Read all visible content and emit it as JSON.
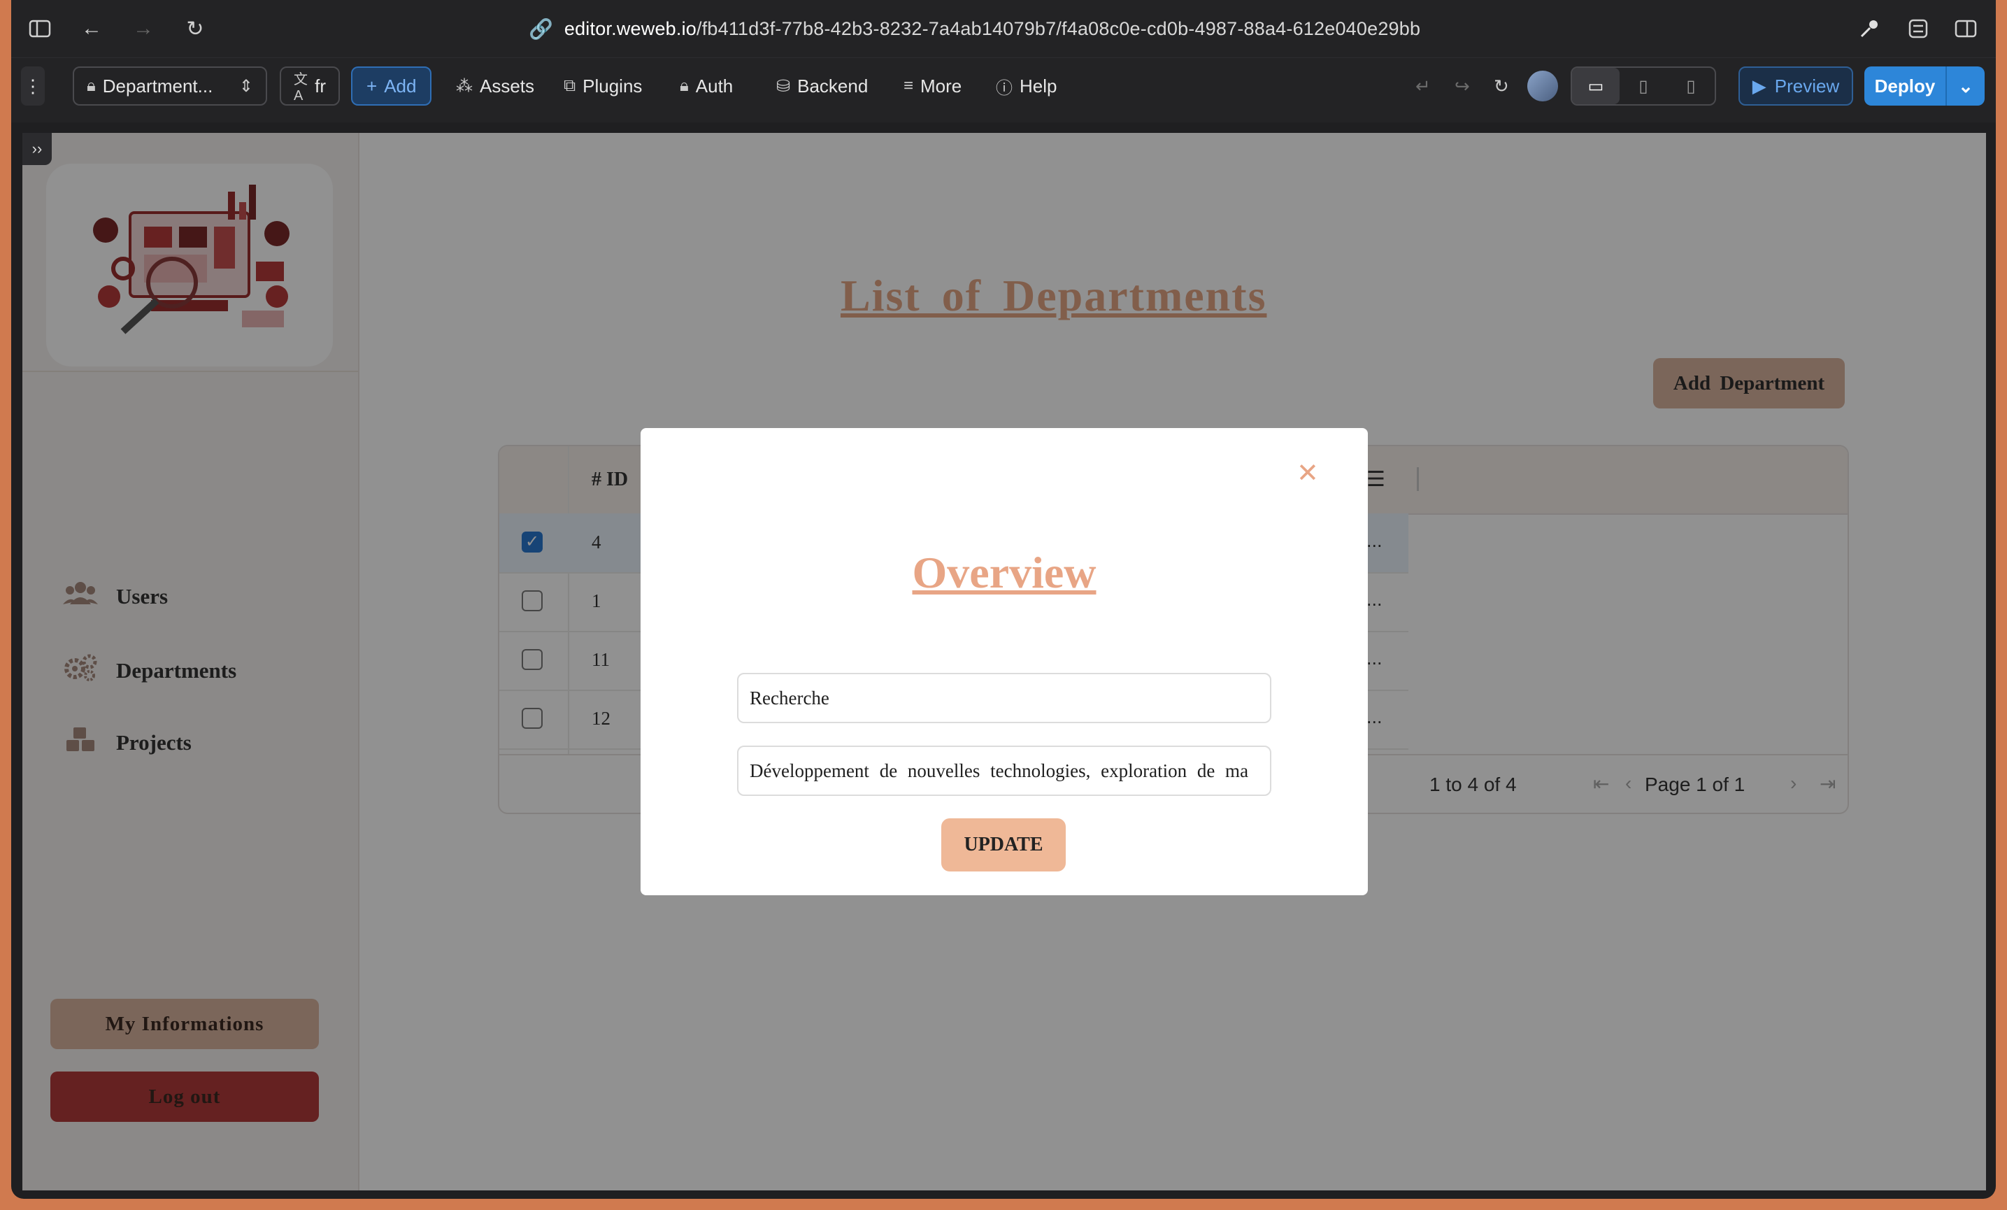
{
  "browser": {
    "url_host": "editor.weweb.io",
    "url_path": "/fb411d3f-77b8-42b3-8232-7a4ab14079b7/f4a08c0e-cd0b-4987-88a4-612e040e29bb"
  },
  "toolbar": {
    "page_selector": "Department...",
    "language": "fr",
    "add": "Add",
    "assets": "Assets",
    "plugins": "Plugins",
    "auth": "Auth",
    "backend": "Backend",
    "more": "More",
    "help": "Help",
    "preview": "Preview",
    "deploy": "Deploy"
  },
  "sidebar": {
    "items": [
      {
        "label": "Users",
        "icon": "users-icon"
      },
      {
        "label": "Departments",
        "icon": "gears-icon"
      },
      {
        "label": "Projects",
        "icon": "boxes-icon"
      }
    ],
    "my_info_button": "My Informations",
    "logout_button": "Log out"
  },
  "main": {
    "title": "List of Departments",
    "add_button": "Add Department",
    "table": {
      "id_header": "# ID",
      "rows": [
        {
          "id": "4",
          "selected": true,
          "trail": "..."
        },
        {
          "id": "1",
          "selected": false,
          "trail": "..."
        },
        {
          "id": "11",
          "selected": false,
          "trail": "..."
        },
        {
          "id": "12",
          "selected": false,
          "trail": "..."
        }
      ],
      "pagination": {
        "count": "1 to 4 of 4",
        "page": "Page 1 of 1"
      }
    }
  },
  "modal": {
    "title": "Overview",
    "name_value": "Recherche",
    "description_value": "Développement de nouvelles technologies, exploration de ma",
    "update_button": "UPDATE"
  },
  "colors": {
    "accent": "#e8a585",
    "brand_button": "#efb897",
    "logout": "#b23a3a",
    "deploy": "#2d86d9"
  }
}
